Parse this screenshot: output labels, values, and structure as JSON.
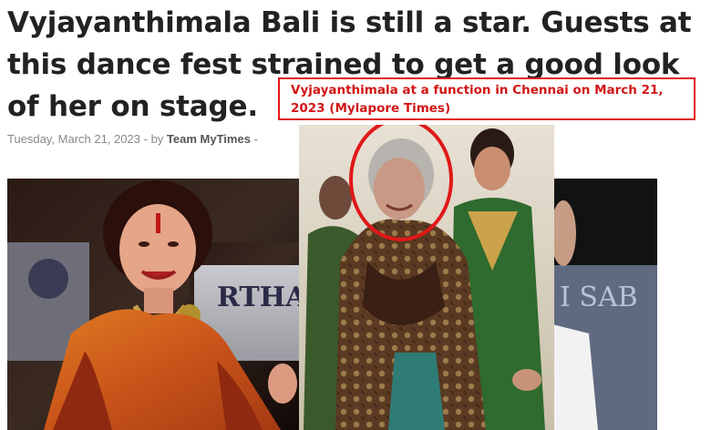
{
  "article": {
    "headline": "Vyjayanthimala Bali is still a star. Guests at this dance fest strained to get a good look of her on stage.",
    "date": "Tuesday, March 21, 2023",
    "separator": "-",
    "by_prefix": "by",
    "author": "Team MyTimes",
    "trailing_separator": "-"
  },
  "annotation": {
    "caption": "Vyjayanthimala at a function in Chennai on March 21, 2023 (Mylapore Times)",
    "border_color": "#e01818",
    "text_color": "#d21515"
  },
  "images": {
    "left": {
      "description_icon": "photo"
    },
    "middle": {
      "description_icon": "photo",
      "highlight": "red-circle"
    },
    "right": {
      "description_icon": "photo"
    }
  },
  "colors": {
    "headline": "#222222",
    "byline": "#888888",
    "accent_red": "#e01818"
  }
}
